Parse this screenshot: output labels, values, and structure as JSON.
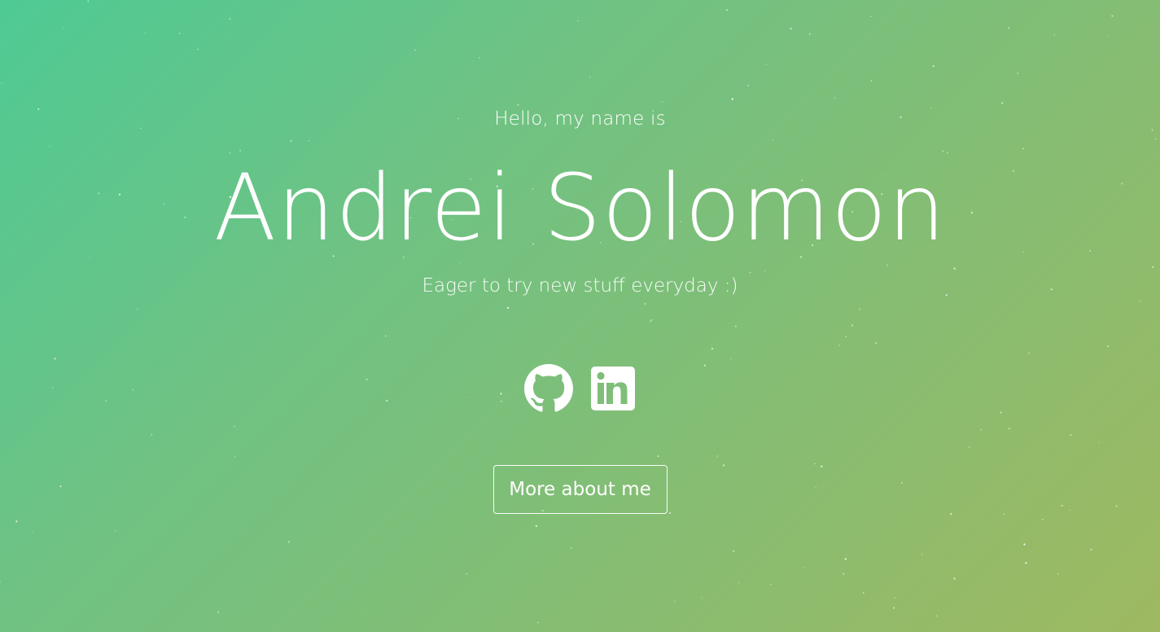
{
  "hero": {
    "greeting": "Hello, my name is",
    "name": "Andrei Solomon",
    "tagline": "Eager to try new stuff everyday :)",
    "cta_label": "More about me",
    "socials": [
      {
        "icon": "github-icon",
        "label": "GitHub"
      },
      {
        "icon": "linkedin-icon",
        "label": "LinkedIn"
      }
    ],
    "colors": {
      "gradient_start": "#4fca94",
      "gradient_end": "#9eb961",
      "text": "#ffffff"
    }
  }
}
